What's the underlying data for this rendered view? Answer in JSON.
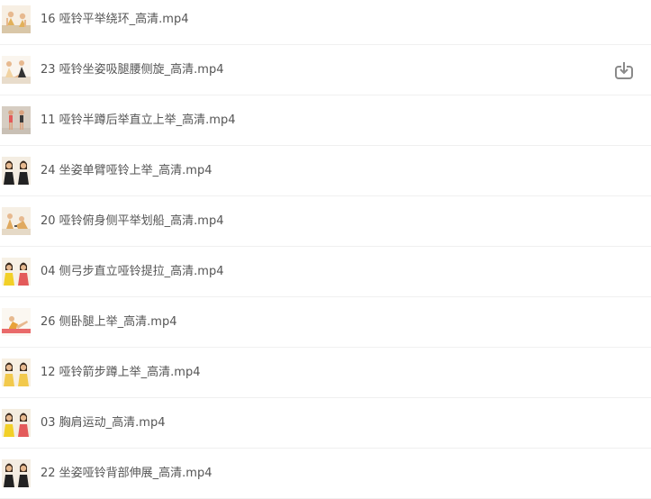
{
  "files": [
    {
      "name": "16 哑铃平举绕环_高清.mp4",
      "thumb": "two-figures-crouching",
      "skin": "#e7b98f",
      "outfit": "#e2b15a",
      "floor": "#d9c7a8"
    },
    {
      "name": "23 哑铃坐姿吸腿腰侧旋_高清.mp4",
      "thumb": "two-figures-seated",
      "skin": "#e7b98f",
      "outfit": "#f1d3a2",
      "floor": "#e8dccb",
      "download_icon": "download-icon"
    },
    {
      "name": "11 哑铃半蹲后举直立上举_高清.mp4",
      "thumb": "two-figures-standing",
      "skin": "#d9a27f",
      "outfit": "#e35a5a",
      "floor": "#c9c0b5"
    },
    {
      "name": "24 坐姿单臂哑铃上举_高清.mp4",
      "thumb": "two-figures-portrait",
      "skin": "#e7b98f",
      "outfit": "#222222",
      "floor": "#ece3d4"
    },
    {
      "name": "20 哑铃俯身侧平举划船_高清.mp4",
      "thumb": "two-figures-bent-over",
      "skin": "#e7b98f",
      "outfit": "#e0a95e",
      "floor": "#e5d9c6"
    },
    {
      "name": "04 侧弓步直立哑铃提拉_高清.mp4",
      "thumb": "two-figures-lunge",
      "skin": "#e7b98f",
      "outfit": "#f2d027",
      "floor": "#f0e8d8"
    },
    {
      "name": "26 侧卧腿上举_高清.mp4",
      "thumb": "figure-lying-on-mat",
      "skin": "#e7b98f",
      "outfit": "#e8a23a",
      "floor": "#e96a6a"
    },
    {
      "name": "12 哑铃箭步蹲上举_高清.mp4",
      "thumb": "two-figures-portrait",
      "skin": "#e7b98f",
      "outfit": "#f2c94c",
      "floor": "#f1e6d0"
    },
    {
      "name": "03 胸肩运动_高清.mp4",
      "thumb": "two-figures-portrait",
      "skin": "#e7b98f",
      "outfit": "#f2d027",
      "floor": "#efe7d8"
    },
    {
      "name": "22 坐姿哑铃背部伸展_高清.mp4",
      "thumb": "two-figures-portrait",
      "skin": "#e7b98f",
      "outfit": "#222222",
      "floor": "#ece3d4"
    }
  ],
  "colors": {
    "text": "#555555",
    "divider": "#f0f0f0",
    "icon": "#8a8a8a"
  }
}
